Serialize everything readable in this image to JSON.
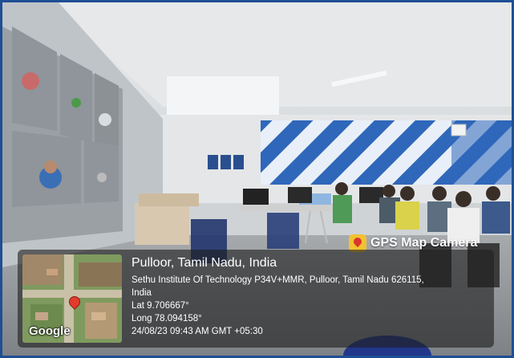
{
  "stamp": {
    "app_label": "GPS Map Camera",
    "place": "Pulloor, Tamil Nadu, India",
    "address_line1": "Sethu Institute Of Technology P34V+MMR, Pulloor, Tamil Nadu 626115,",
    "address_line2": "India",
    "lat": "Lat 9.706667°",
    "long": "Long 78.094158°",
    "datetime": "24/08/23 09:43 AM GMT +05:30",
    "map_brand": "Google",
    "icons": {
      "app": "map-pin-icon",
      "location": "location-marker-icon"
    }
  },
  "colors": {
    "border": "#1f4e94",
    "pattern_blue": "#2d63b5",
    "pattern_light": "#e8eef7",
    "overlay": "#1e1e1e"
  }
}
